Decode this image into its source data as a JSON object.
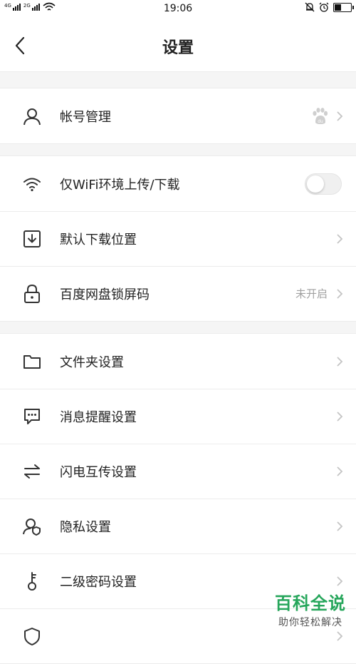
{
  "status_bar": {
    "net1": "4G",
    "net2": "2G",
    "time": "19:06",
    "icons": [
      "signal-icon",
      "wifi-icon",
      "bell-off-icon",
      "alarm-icon",
      "battery-icon"
    ]
  },
  "header": {
    "title": "设置"
  },
  "groups": [
    {
      "items": [
        {
          "label": "帐号管理",
          "icon": "user-icon",
          "right": "baidu-paw-logo"
        }
      ]
    },
    {
      "items": [
        {
          "label": "仅WiFi环境上传/下载",
          "icon": "wifi-icon",
          "right": "toggle",
          "toggle_on": false
        },
        {
          "label": "默认下载位置",
          "icon": "download-icon",
          "right": "chevron"
        },
        {
          "label": "百度网盘锁屏码",
          "icon": "lock-icon",
          "right": "value",
          "value": "未开启"
        }
      ]
    },
    {
      "items": [
        {
          "label": "文件夹设置",
          "icon": "folder-icon",
          "right": "chevron"
        },
        {
          "label": "消息提醒设置",
          "icon": "message-icon",
          "right": "chevron"
        },
        {
          "label": "闪电互传设置",
          "icon": "transfer-icon",
          "right": "chevron"
        },
        {
          "label": "隐私设置",
          "icon": "privacy-icon",
          "right": "chevron"
        },
        {
          "label": "二级密码设置",
          "icon": "key-icon",
          "right": "chevron"
        },
        {
          "label": "",
          "icon": "shield-icon",
          "right": "chevron"
        }
      ]
    }
  ],
  "watermark": {
    "main": "百科全说",
    "sub": "助你轻松解决"
  },
  "colors": {
    "watermark": "#26a65b",
    "label": "#222222",
    "muted": "#a0a0a0",
    "icon": "#333333"
  }
}
